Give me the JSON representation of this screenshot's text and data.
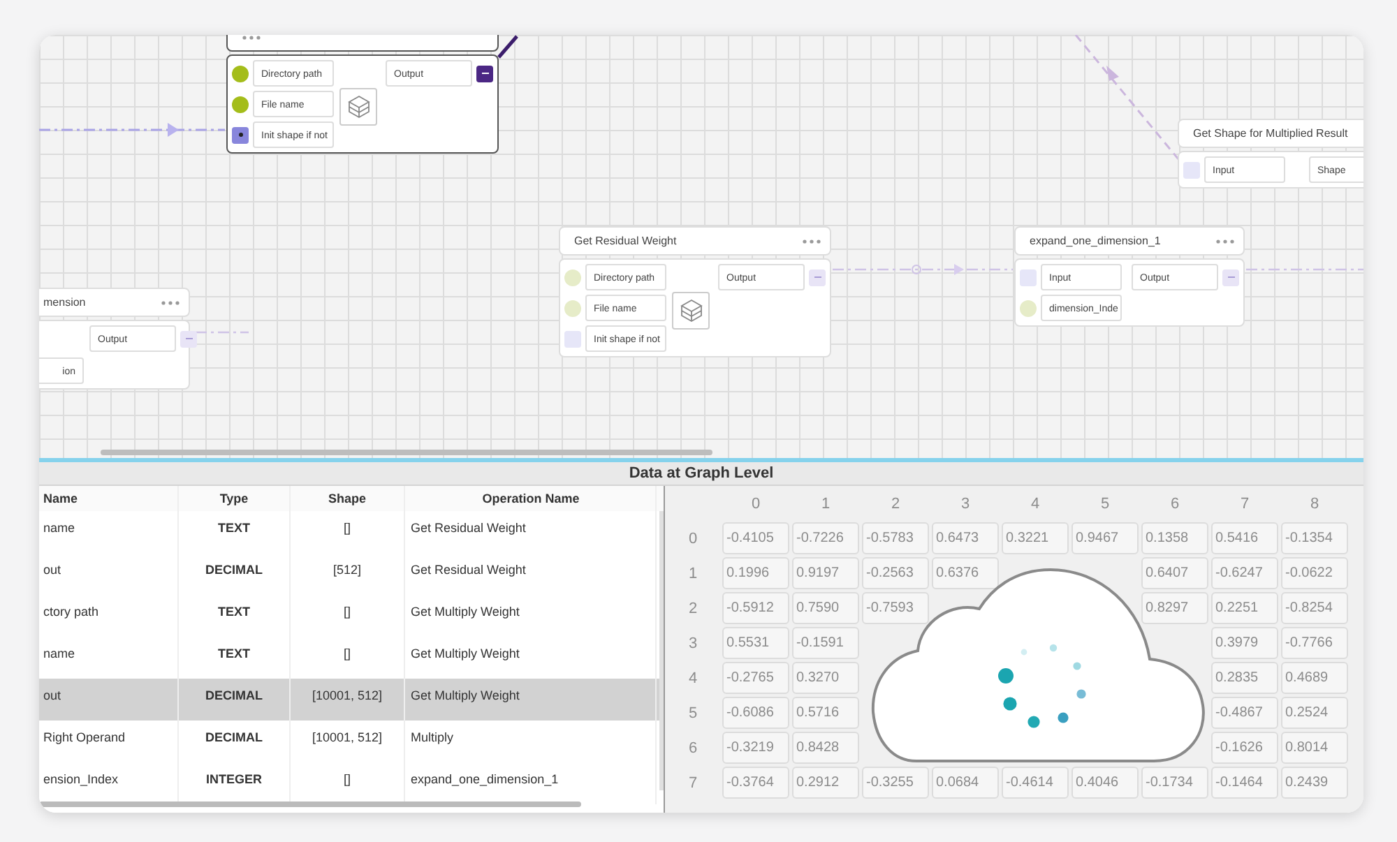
{
  "graph": {
    "nodes": [
      {
        "selected": true,
        "icon": true,
        "inputs": [
          {
            "label": "Directory path",
            "kind": "dot"
          },
          {
            "label": "File name",
            "kind": "dot"
          },
          {
            "label": "Init shape if not",
            "kind": "square"
          }
        ],
        "output": "Output"
      },
      {
        "title": "Get Residual Weight",
        "selected": false,
        "icon": true,
        "inputs": [
          {
            "label": "Directory path",
            "kind": "dot"
          },
          {
            "label": "File name",
            "kind": "dot"
          },
          {
            "label": "Init shape if not",
            "kind": "square"
          }
        ],
        "output": "Output"
      },
      {
        "title": "expand_one_dimension_1",
        "selected": false,
        "icon": false,
        "inputs": [
          {
            "label": "Input",
            "kind": "square"
          },
          {
            "label": "dimension_Inde",
            "kind": "dot"
          }
        ],
        "output": "Output"
      },
      {
        "title": "mension",
        "selected": false,
        "icon": false,
        "inputs": [
          {
            "label": "ion",
            "kind": "field"
          }
        ],
        "output": "Output"
      },
      {
        "title": "Get Shape for Multiplied Result",
        "selected": false,
        "icon": false,
        "inputs": [
          {
            "label": "Input",
            "kind": "square"
          }
        ],
        "output": "Shape"
      }
    ]
  },
  "panel_title": "Data at Graph Level",
  "table": {
    "columns": [
      "Name",
      "Type",
      "Shape",
      "Operation Name"
    ],
    "rows": [
      {
        "cells": [
          "name",
          "TEXT",
          "[]",
          "Get Residual Weight"
        ],
        "selected": false
      },
      {
        "cells": [
          "out",
          "DECIMAL",
          "[512]",
          "Get Residual Weight"
        ],
        "selected": false
      },
      {
        "cells": [
          "ctory path",
          "TEXT",
          "[]",
          "Get Multiply Weight"
        ],
        "selected": false
      },
      {
        "cells": [
          "name",
          "TEXT",
          "[]",
          "Get Multiply Weight"
        ],
        "selected": false
      },
      {
        "cells": [
          "out",
          "DECIMAL",
          "[10001, 512]",
          "Get Multiply Weight"
        ],
        "selected": true
      },
      {
        "cells": [
          "Right Operand",
          "DECIMAL",
          "[10001, 512]",
          "Multiply"
        ],
        "selected": false
      },
      {
        "cells": [
          "ension_Index",
          "INTEGER",
          "[]",
          "expand_one_dimension_1"
        ],
        "selected": false
      }
    ]
  },
  "matrix": {
    "columns": [
      "0",
      "1",
      "2",
      "3",
      "4",
      "5",
      "6",
      "7",
      "8"
    ],
    "rows": [
      {
        "index": "0",
        "values": [
          {
            "text": "-0.4105",
            "covered": false
          },
          {
            "text": "-0.7226",
            "covered": false
          },
          {
            "text": "-0.5783",
            "covered": false
          },
          {
            "text": "0.6473",
            "covered": false
          },
          {
            "text": "0.3221",
            "covered": false
          },
          {
            "text": "0.9467",
            "covered": false
          },
          {
            "text": "0.1358",
            "covered": false
          },
          {
            "text": "0.5416",
            "covered": false
          },
          {
            "text": "-0.1354",
            "covered": false
          }
        ]
      },
      {
        "index": "1",
        "values": [
          {
            "text": "0.1996",
            "covered": false
          },
          {
            "text": "0.9197",
            "covered": false
          },
          {
            "text": "-0.2563",
            "covered": false
          },
          {
            "text": "0.6376",
            "covered": false
          },
          {
            "covered": true
          },
          {
            "covered": true
          },
          {
            "text": "0.6407",
            "covered": false
          },
          {
            "text": "-0.6247",
            "covered": false
          },
          {
            "text": "-0.0622",
            "covered": false
          }
        ]
      },
      {
        "index": "2",
        "values": [
          {
            "text": "-0.5912",
            "covered": false
          },
          {
            "text": "0.7590",
            "covered": false
          },
          {
            "text": "-0.7593",
            "covered": false
          },
          {
            "covered": true
          },
          {
            "covered": true
          },
          {
            "covered": true
          },
          {
            "text": "0.8297",
            "covered": false
          },
          {
            "text": "0.2251",
            "covered": false
          },
          {
            "text": "-0.8254",
            "covered": false
          }
        ]
      },
      {
        "index": "3",
        "values": [
          {
            "text": "0.5531",
            "covered": false
          },
          {
            "text": "-0.1591",
            "covered": false
          },
          {
            "covered": true
          },
          {
            "covered": true
          },
          {
            "covered": true
          },
          {
            "covered": true
          },
          {
            "covered": true
          },
          {
            "text": "0.3979",
            "covered": false
          },
          {
            "text": "-0.7766",
            "covered": false
          }
        ]
      },
      {
        "index": "4",
        "values": [
          {
            "text": "-0.2765",
            "covered": false
          },
          {
            "text": "0.3270",
            "covered": false
          },
          {
            "covered": true
          },
          {
            "covered": true
          },
          {
            "covered": true
          },
          {
            "covered": true
          },
          {
            "covered": true
          },
          {
            "text": "0.2835",
            "covered": false
          },
          {
            "text": "0.4689",
            "covered": false
          }
        ]
      },
      {
        "index": "5",
        "values": [
          {
            "text": "-0.6086",
            "covered": false
          },
          {
            "text": "0.5716",
            "covered": false
          },
          {
            "covered": true
          },
          {
            "covered": true
          },
          {
            "covered": true
          },
          {
            "covered": true
          },
          {
            "covered": true
          },
          {
            "text": "-0.4867",
            "covered": false
          },
          {
            "text": "0.2524",
            "covered": false
          }
        ]
      },
      {
        "index": "6",
        "values": [
          {
            "text": "-0.3219",
            "covered": false
          },
          {
            "text": "0.8428",
            "covered": false
          },
          {
            "covered": true
          },
          {
            "covered": true
          },
          {
            "covered": true
          },
          {
            "covered": true
          },
          {
            "covered": true
          },
          {
            "text": "-0.1626",
            "covered": false
          },
          {
            "text": "0.8014",
            "covered": false
          }
        ]
      },
      {
        "index": "7",
        "values": [
          {
            "text": "-0.3764",
            "covered": false
          },
          {
            "text": "0.2912",
            "covered": false
          },
          {
            "text": "-0.3255",
            "covered": false
          },
          {
            "text": "0.0684",
            "covered": false
          },
          {
            "text": "-0.4614",
            "covered": false
          },
          {
            "text": "0.4046",
            "covered": false
          },
          {
            "text": "-0.1734",
            "covered": false
          },
          {
            "text": "-0.1464",
            "covered": false
          },
          {
            "text": "0.2439",
            "covered": false
          }
        ]
      }
    ]
  }
}
